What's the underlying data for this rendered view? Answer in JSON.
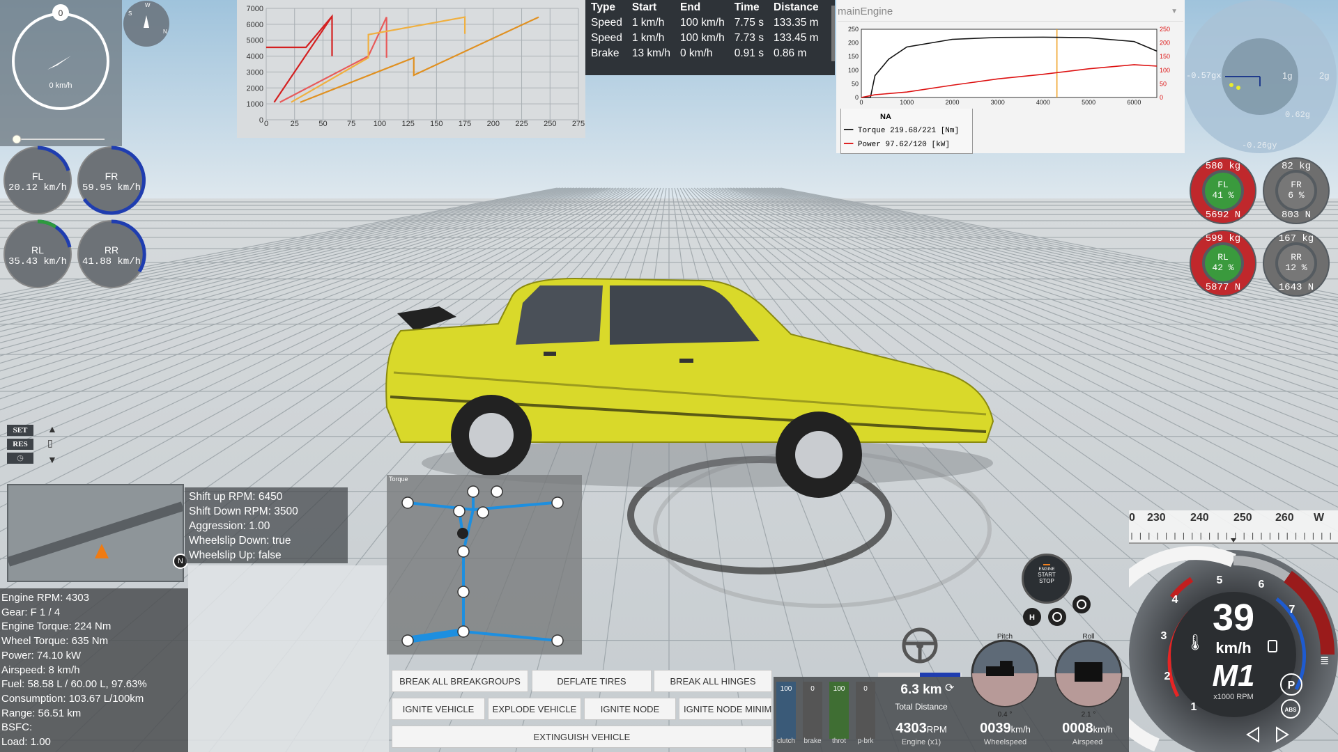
{
  "compass": {
    "value": "0",
    "speed": "0 km/h"
  },
  "minicompass": {
    "letters": [
      "S",
      "W",
      "N"
    ]
  },
  "wheel_speeds": [
    {
      "id": "FL",
      "value": "20.12 km/h"
    },
    {
      "id": "FR",
      "value": "59.95 km/h"
    },
    {
      "id": "RL",
      "value": "35.43 km/h"
    },
    {
      "id": "RR",
      "value": "41.88 km/h"
    }
  ],
  "cruise": {
    "set": "SET",
    "res": "RES"
  },
  "map": {
    "n": "N"
  },
  "shift_info": [
    "Shift up RPM: 6450",
    "Shift Down RPM: 3500",
    "Aggression: 1.00",
    "Wheelslip Down: true",
    "Wheelslip Up: false"
  ],
  "engine_info": [
    "Engine RPM: 4303",
    "Gear: F 1 / 4",
    "Engine Torque: 224 Nm",
    "Wheel Torque: 635 Nm",
    "Power: 74.10 kW",
    "Airspeed: 8 km/h",
    "Fuel: 58.58 L / 60.00 L, 97.63%",
    "Consumption: 103.67 L/100km",
    "Range: 56.51 km",
    "BSFC:",
    "Load: 1.00"
  ],
  "gear_chart": {
    "y_ticks": [
      "7000",
      "6000",
      "5000",
      "4000",
      "3000",
      "2000",
      "1000",
      "0"
    ],
    "x_ticks": [
      "0",
      "25",
      "50",
      "75",
      "100",
      "125",
      "150",
      "175",
      "200",
      "225",
      "250",
      "275"
    ]
  },
  "chart_data": [
    {
      "type": "line",
      "title": "",
      "xlim": [
        0,
        275
      ],
      "ylim": [
        0,
        7000
      ],
      "grid": true,
      "series": [
        {
          "color": "#d42020",
          "x": [
            0,
            35,
            58,
            58
          ],
          "y": [
            4550,
            4550,
            6500,
            4000
          ]
        },
        {
          "color": "#d42020",
          "x": [
            7,
            58
          ],
          "y": [
            1100,
            6500
          ]
        },
        {
          "color": "#e85a5a",
          "x": [
            12,
            90,
            106,
            106
          ],
          "y": [
            1100,
            4000,
            6450,
            3900
          ]
        },
        {
          "color": "#f0b040",
          "x": [
            22,
            90,
            90,
            175,
            175
          ],
          "y": [
            1100,
            3900,
            5350,
            6450,
            5400
          ]
        },
        {
          "color": "#e09020",
          "x": [
            30,
            130,
            130,
            240
          ],
          "y": [
            1100,
            3900,
            2800,
            6450
          ]
        }
      ]
    },
    {
      "type": "line",
      "title": "",
      "xlim": [
        0,
        6500
      ],
      "ylim": [
        0,
        250
      ],
      "y2lim": [
        0,
        250
      ],
      "x_ticks": [
        "0",
        "1000",
        "2000",
        "3000",
        "4000",
        "5000",
        "6000"
      ],
      "y_ticks": [
        "250",
        "200",
        "150",
        "100",
        "50",
        "0"
      ],
      "y2_ticks": [
        "250",
        "200",
        "150",
        "100",
        "50",
        "0"
      ],
      "series": [
        {
          "name": "Torque",
          "color": "#111111",
          "x": [
            0,
            200,
            300,
            600,
            1000,
            2000,
            3000,
            4000,
            5000,
            6000,
            6500
          ],
          "y": [
            0,
            0,
            80,
            140,
            185,
            213,
            220,
            221,
            219,
            205,
            170
          ]
        },
        {
          "name": "Power",
          "color": "#dd1111",
          "x": [
            0,
            300,
            1000,
            2000,
            3000,
            4000,
            5000,
            6000,
            6500
          ],
          "y": [
            0,
            10,
            20,
            45,
            68,
            85,
            105,
            120,
            115
          ]
        }
      ],
      "marker_rpm": 4303
    }
  ],
  "accel_table": {
    "headers": [
      "Type",
      "Start",
      "End",
      "Time",
      "Distance"
    ],
    "rows": [
      [
        "Speed",
        "1 km/h",
        "100 km/h",
        "7.75 s",
        "133.35 m"
      ],
      [
        "Speed",
        "1 km/h",
        "100 km/h",
        "7.73 s",
        "133.45 m"
      ],
      [
        "Brake",
        "13 km/h",
        "0 km/h",
        "0.91 s",
        "0.86 m"
      ]
    ]
  },
  "engine_graph": {
    "dropdown": "mainEngine",
    "legend_title": "NA",
    "legend": [
      {
        "label": "Torque",
        "value": "219.68/221",
        "unit": "[Nm]",
        "color": "#111111"
      },
      {
        "label": "Power",
        "value": "97.62/120",
        "unit": "[kW]",
        "color": "#dd1111"
      }
    ]
  },
  "gforce": {
    "x": "-0.57gx",
    "g1": "1g",
    "g2": "2g",
    "y1": "0.62g",
    "y2": "-0.26gy"
  },
  "tire_loads": [
    {
      "id": "FL",
      "top": "580 kg",
      "pct": "41 %",
      "bottom": "5692 N",
      "color": "#c0282c"
    },
    {
      "id": "FR",
      "top": "82 kg",
      "pct": "6 %",
      "bottom": "803 N",
      "color": "#6e6e6e"
    },
    {
      "id": "RL",
      "top": "599 kg",
      "pct": "42 %",
      "bottom": "5877 N",
      "color": "#c0282c"
    },
    {
      "id": "RR",
      "top": "167 kg",
      "pct": "12 %",
      "bottom": "1643 N",
      "color": "#6e6e6e"
    }
  ],
  "powertrain": {
    "title": "Torque"
  },
  "buttons": {
    "break_all_breakgroups": "BREAK ALL BREAKGROUPS",
    "deflate_tires": "DEFLATE TIRES",
    "break_all_hinges": "BREAK ALL HINGES",
    "ignite_vehicle": "IGNITE VEHICLE",
    "explode_vehicle": "EXPLODE VEHICLE",
    "ignite_node": "IGNITE NODE",
    "ignite_node_minimal": "IGNITE NODE MINIMAL",
    "extinguish_vehicle": "EXTINGUISH VEHICLE"
  },
  "pedals": [
    {
      "label": "clutch",
      "value": "100",
      "level": 1.0,
      "color": "#3a5a78"
    },
    {
      "label": "brake",
      "value": "0",
      "level": 0.0,
      "color": "#666666"
    },
    {
      "label": "throt",
      "value": "100",
      "level": 1.0,
      "color": "#3f6e33"
    },
    {
      "label": "p-brk",
      "value": "0",
      "level": 0.0,
      "color": "#666666"
    }
  ],
  "trip": {
    "distance": "6.3 km",
    "distance_label": "Total Distance"
  },
  "readouts": [
    {
      "value": "4303",
      "unit": "RPM",
      "label": "Engine (x1)"
    },
    {
      "value": "0039",
      "unit": "km/h",
      "label": "Wheelspeed"
    },
    {
      "value": "0008",
      "unit": "km/h",
      "label": "Airspeed"
    }
  ],
  "start_stop": {
    "l1": "ENGINE",
    "l2": "START",
    "l3": "STOP"
  },
  "attitude": {
    "pitch_label": "Pitch",
    "roll_label": "Roll",
    "pitch_value": "0.4 °",
    "roll_value": "2.1 °"
  },
  "heading_strip": {
    "labels": [
      "0",
      "230",
      "240",
      "250",
      "260",
      "W"
    ]
  },
  "speedo": {
    "speed": "39",
    "unit": "km/h",
    "gear": "M1",
    "rpm_label": "x1000 RPM",
    "ticks": [
      "1",
      "2",
      "3",
      "4",
      "5",
      "6",
      "7"
    ],
    "abs": "ABS",
    "park": "P"
  }
}
